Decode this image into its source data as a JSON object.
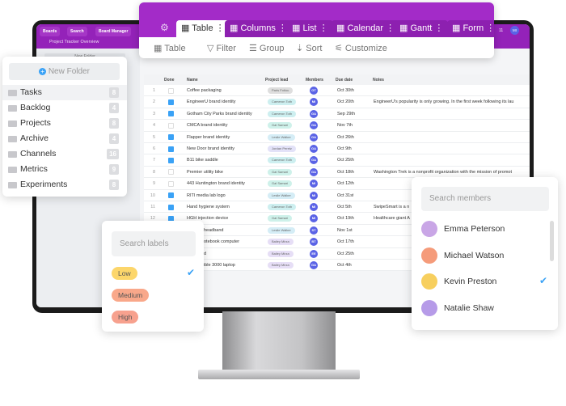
{
  "app": {
    "topbar": {
      "buttons": [
        "Boards",
        "Search",
        "Board Manager"
      ],
      "breadcrumb": "Project Tracker Overview",
      "new_folder": "New Folder",
      "notifications": "11",
      "user_initials": "MI"
    }
  },
  "view_tabs": [
    {
      "label": "Table",
      "active": true
    },
    {
      "label": "Columns"
    },
    {
      "label": "List"
    },
    {
      "label": "Calendar"
    },
    {
      "label": "Gantt"
    },
    {
      "label": "Form"
    }
  ],
  "toolbar": [
    "Table",
    "Filter",
    "Group",
    "Sort",
    "Customize"
  ],
  "table": {
    "columns": [
      "Done",
      "Name",
      "Project lead",
      "Members",
      "Due date",
      "Notes"
    ],
    "rows": [
      {
        "n": "1",
        "done": false,
        "name": "Coffee packaging",
        "lead": "Paris Fotiou",
        "lead_color": "#dedede",
        "member": "GT",
        "due": "Oct 30th",
        "notes": ""
      },
      {
        "n": "2",
        "done": true,
        "name": "EngineerU brand identity",
        "lead": "Cameron Toth",
        "lead_color": "#cdeff0",
        "member": "MI",
        "due": "Oct 20th",
        "notes": "EngineerU's popularity is only growing. In the first week following its lau"
      },
      {
        "n": "3",
        "done": true,
        "name": "Gotham City Parks brand identity",
        "lead": "Cameron Toth",
        "lead_color": "#cdeff0",
        "member": "GA",
        "due": "Sep 29th",
        "notes": ""
      },
      {
        "n": "4",
        "done": false,
        "name": "CMCA brand identity",
        "lead": "Gal Samari",
        "lead_color": "#cef1ea",
        "member": "GA",
        "due": "Nov 7th",
        "notes": ""
      },
      {
        "n": "5",
        "done": true,
        "name": "Flapper brand identity",
        "lead": "Leslie Walker",
        "lead_color": "#d5edf6",
        "member": "GA",
        "due": "Oct 26th",
        "notes": ""
      },
      {
        "n": "6",
        "done": true,
        "name": "New Door brand identity",
        "lead": "Jordan Peretz",
        "lead_color": "#e3e2f8",
        "member": "GA",
        "due": "Oct 9th",
        "notes": ""
      },
      {
        "n": "7",
        "done": true,
        "name": "B11 bike saddle",
        "lead": "Cameron Toth",
        "lead_color": "#cdeff0",
        "member": "GA",
        "due": "Oct 25th",
        "notes": ""
      },
      {
        "n": "8",
        "done": false,
        "name": "Premier utility bike",
        "lead": "Gal Samari",
        "lead_color": "#cef1ea",
        "member": "GA",
        "due": "Oct 18th",
        "notes": "Washington Trek is a nonprofit organization with the mission of promot"
      },
      {
        "n": "9",
        "done": false,
        "name": "443 Huntington brand identity",
        "lead": "Gal Samari",
        "lead_color": "#cef1ea",
        "member": "MI",
        "due": "Oct 12th",
        "notes": ""
      },
      {
        "n": "10",
        "done": true,
        "name": "RITI media lab logo",
        "lead": "Leslie Walker",
        "lead_color": "#d5edf6",
        "member": "MI",
        "due": "Oct 31st",
        "notes": ""
      },
      {
        "n": "11",
        "done": true,
        "name": "Hand hygiene system",
        "lead": "Cameron Toth",
        "lead_color": "#cdeff0",
        "member": "MI",
        "due": "Oct 5th",
        "notes": "SwipeSmart is a n"
      },
      {
        "n": "12",
        "done": true,
        "name": "HGH injection device",
        "lead": "Gal Samari",
        "lead_color": "#cef1ea",
        "member": "MI",
        "due": "Oct 19th",
        "notes": "Healthcare giant A"
      },
      {
        "n": "",
        "done": false,
        "name": "headband",
        "lead": "Leslie Walker",
        "lead_color": "#d5edf6",
        "member": "ST",
        "due": "Nov 1st",
        "notes": ""
      },
      {
        "n": "",
        "done": false,
        "name": "otebook computer",
        "lead": "Bailey Mirza",
        "lead_color": "#e6def6",
        "member": "BT",
        "due": "Oct 17th",
        "notes": ""
      },
      {
        "n": "",
        "done": false,
        "name": "d",
        "lead": "Bailey Mirza",
        "lead_color": "#e6def6",
        "member": "EE",
        "due": "Oct 25th",
        "notes": ""
      },
      {
        "n": "",
        "done": false,
        "name": "ible 3000 laptop",
        "lead": "Bailey Mirza",
        "lead_color": "#e6def6",
        "member": "GA",
        "due": "Oct 4th",
        "notes": ""
      }
    ]
  },
  "folders": {
    "new_folder": "New Folder",
    "items": [
      {
        "label": "Tasks",
        "count": "8"
      },
      {
        "label": "Backlog",
        "count": "4"
      },
      {
        "label": "Projects",
        "count": "8"
      },
      {
        "label": "Archive",
        "count": "4"
      },
      {
        "label": "Channels",
        "count": "16"
      },
      {
        "label": "Metrics",
        "count": "9"
      },
      {
        "label": "Experiments",
        "count": "8"
      }
    ]
  },
  "labels": {
    "placeholder": "Search labels",
    "items": [
      {
        "label": "Low",
        "color": "#fcd66b",
        "selected": true
      },
      {
        "label": "Medium",
        "color": "#f9a88a"
      },
      {
        "label": "High",
        "color": "#f7a18e"
      }
    ]
  },
  "members": {
    "placeholder": "Search members",
    "items": [
      {
        "name": "Emma Peterson",
        "color": "#c9a6e6"
      },
      {
        "name": "Michael Watson",
        "color": "#f59b7a"
      },
      {
        "name": "Kevin Preston",
        "color": "#f7cf5e",
        "selected": true
      },
      {
        "name": "Natalie Shaw",
        "color": "#b69be8"
      }
    ]
  },
  "colors": {
    "brand": "#a32bc8",
    "accent": "#3aa2f6",
    "avatar": "#5a63e6"
  }
}
